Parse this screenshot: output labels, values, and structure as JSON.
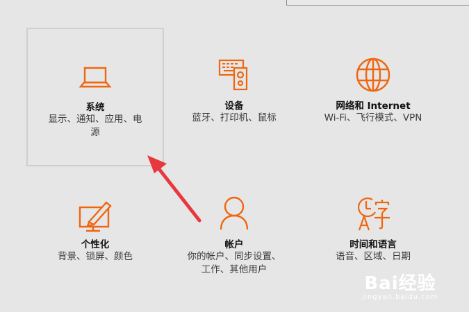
{
  "colors": {
    "accent": "#f0650f",
    "background": "#e6e6e6",
    "arrow": "#e8383d"
  },
  "tiles": [
    {
      "title": "系统",
      "desc_lines": [
        "显示、通知、应用、电",
        "源"
      ],
      "icon": "laptop-icon"
    },
    {
      "title": "设备",
      "desc_lines": [
        "蓝牙、打印机、鼠标"
      ],
      "icon": "devices-icon"
    },
    {
      "title": "网络和 Internet",
      "desc_lines": [
        "Wi-Fi、飞行模式、VPN"
      ],
      "icon": "globe-icon"
    },
    {
      "title": "个性化",
      "desc_lines": [
        "背景、锁屏、颜色"
      ],
      "icon": "personalization-icon"
    },
    {
      "title": "帐户",
      "desc_lines": [
        "你的帐户、同步设置、",
        "工作、其他用户"
      ],
      "icon": "person-icon"
    },
    {
      "title": "时间和语言",
      "desc_lines": [
        "语音、区域、日期"
      ],
      "icon": "time-language-icon"
    }
  ],
  "watermark": {
    "logo": "Bai经验",
    "url": "jingyan.baidu.com"
  }
}
